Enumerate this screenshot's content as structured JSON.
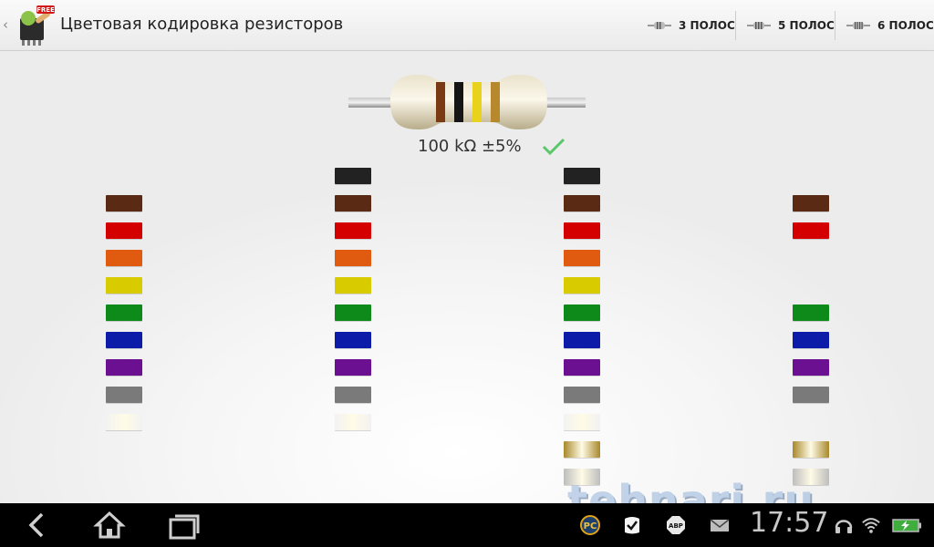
{
  "app": {
    "title": "Цветовая кодировка резисторов",
    "icon_badge": "FREE"
  },
  "tabs": [
    {
      "label": "3 ПОЛОС"
    },
    {
      "label": "5 ПОЛОС"
    },
    {
      "label": "6 ПОЛОС"
    }
  ],
  "resistor": {
    "value_text": "100 kΩ ±5%",
    "bands": [
      "#7a3b14",
      "#151515",
      "#e8d21c",
      "#b8892c"
    ]
  },
  "palette": {
    "black": "#222222",
    "brown": "#5a2a14",
    "red": "#d40000",
    "orange": "#e05a10",
    "yellow": "#d8cc00",
    "green": "#0e8a1a",
    "blue": "#0c1ca8",
    "violet": "#6a1090",
    "grey": "#7a7a7a",
    "white": "#f2f2f2",
    "gold": "#a8882a",
    "silver": "#bdbdbd"
  },
  "columns": [
    {
      "colors": [
        "brown",
        "red",
        "orange",
        "yellow",
        "green",
        "blue",
        "violet",
        "grey",
        "white"
      ]
    },
    {
      "colors": [
        "black",
        "brown",
        "red",
        "orange",
        "yellow",
        "green",
        "blue",
        "violet",
        "grey",
        "white"
      ]
    },
    {
      "colors": [
        "black",
        "brown",
        "red",
        "orange",
        "yellow",
        "green",
        "blue",
        "violet",
        "grey",
        "white",
        "gold",
        "silver"
      ]
    },
    {
      "colors": [
        "brown",
        "red",
        "green",
        "blue",
        "violet",
        "grey",
        "gold",
        "silver"
      ]
    }
  ],
  "watermark": "tehnari.ru",
  "status": {
    "time": "17:57"
  }
}
